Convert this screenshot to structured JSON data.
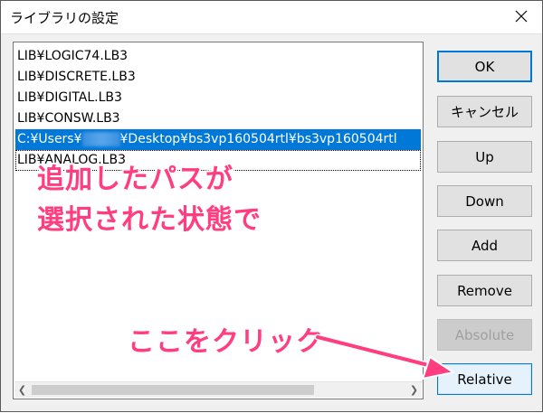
{
  "window": {
    "title": "ライブラリの設定",
    "close_icon": "close-icon"
  },
  "list": {
    "items": [
      {
        "text": "LIB¥LOGIC74.LB3"
      },
      {
        "text": "LIB¥DISCRETE.LB3"
      },
      {
        "text": "LIB¥DIGITAL.LB3"
      },
      {
        "text": "LIB¥CONSW.LB3"
      },
      {
        "text_before": "C:¥Users¥",
        "text_after": "¥Desktop¥bs3vp160504rtl¥bs3vp160504rtl",
        "selected": true
      },
      {
        "text": "LIB¥ANALOG.LB3",
        "focused": true
      }
    ]
  },
  "buttons": {
    "ok": "OK",
    "cancel": "キャンセル",
    "up": "Up",
    "down": "Down",
    "add": "Add",
    "remove": "Remove",
    "absolute": "Absolute",
    "relative": "Relative"
  },
  "annotations": {
    "line1": "追加したパスが",
    "line2": "選択された状態で",
    "click_here": "ここをクリック"
  },
  "colors": {
    "selection": "#0078d7",
    "annotation": "#ff3d7f"
  }
}
